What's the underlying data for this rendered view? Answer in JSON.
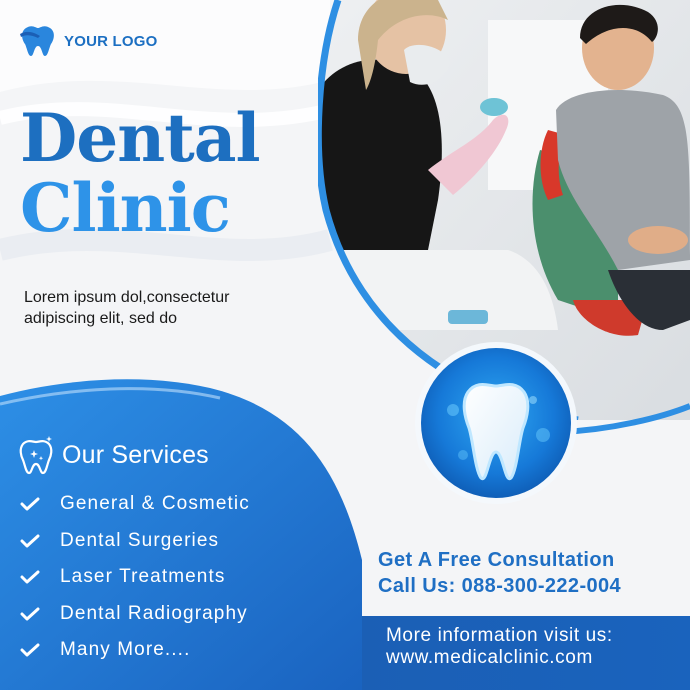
{
  "logo": {
    "icon": "tooth-logo-icon",
    "text": "YOUR LOGO"
  },
  "title": {
    "line1": "Dental",
    "line2": "Clinic"
  },
  "tagline": {
    "line1": "Lorem ipsum dol,consectetur",
    "line2": "adipiscing elit, sed do"
  },
  "services": {
    "icon": "sparkle-tooth-icon",
    "heading": "Our Services",
    "items": [
      {
        "label": "General & Cosmetic"
      },
      {
        "label": "Dental Surgeries"
      },
      {
        "label": "Laser Treatments"
      },
      {
        "label": "Dental Radiography"
      },
      {
        "label": "Many More...."
      }
    ]
  },
  "consultation": {
    "line1": "Get A Free Consultation",
    "line2": "Call Us: 088-300-222-004"
  },
  "footer": {
    "line1": "More information visit us:",
    "line2": "www.medicalclinic.com"
  },
  "photo": {
    "subject": "dentist-with-patient-photo"
  },
  "badge": {
    "icon": "glowing-tooth-icon"
  },
  "colors": {
    "primary": "#1d6fc0",
    "accent": "#2e93e8",
    "footer": "#1b5fb5",
    "background": "#f4f5f7"
  }
}
